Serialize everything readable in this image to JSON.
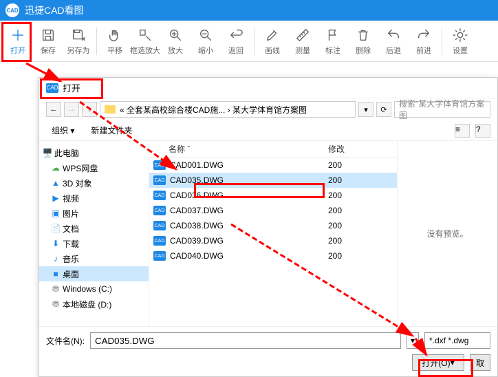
{
  "app": {
    "title": "迅捷CAD看图",
    "icon_text": "CAD"
  },
  "toolbar": [
    {
      "id": "open",
      "label": "打开",
      "accent": true,
      "icon": "plus"
    },
    {
      "id": "save",
      "label": "保存",
      "icon": "save"
    },
    {
      "id": "saveas",
      "label": "另存为",
      "icon": "saveas"
    },
    {
      "sep": true
    },
    {
      "id": "pan",
      "label": "平移",
      "icon": "hand"
    },
    {
      "id": "zoomwin",
      "label": "框选放大",
      "icon": "zoom-win"
    },
    {
      "id": "zoomin",
      "label": "放大",
      "icon": "zoom-in"
    },
    {
      "id": "zoomout",
      "label": "缩小",
      "icon": "zoom-out"
    },
    {
      "id": "back",
      "label": "返回",
      "icon": "return"
    },
    {
      "sep": true
    },
    {
      "id": "line",
      "label": "画线",
      "icon": "pen"
    },
    {
      "id": "measure",
      "label": "测量",
      "icon": "ruler"
    },
    {
      "id": "mark",
      "label": "标注",
      "icon": "flag"
    },
    {
      "id": "delete",
      "label": "删除",
      "icon": "trash"
    },
    {
      "id": "undo",
      "label": "后退",
      "icon": "undo"
    },
    {
      "id": "redo",
      "label": "前进",
      "icon": "redo"
    },
    {
      "sep": true
    },
    {
      "id": "settings",
      "label": "设置",
      "icon": "gear"
    }
  ],
  "dialog": {
    "title": "打开",
    "breadcrumb": "« 全套某高校综合楼CAD施... › 某大学体育馆方案图",
    "search_placeholder": "搜索\"某大学体育馆方案图",
    "organize": "组织",
    "newfolder": "新建文件夹",
    "col_name": "名称",
    "col_mod": "修改",
    "preview_text": "没有预览。",
    "filename_label": "文件名(N):",
    "filename_value": "CAD035.DWG",
    "filter": "*.dxf *.dwg",
    "open_btn": "打开(O)",
    "cancel_btn": "取"
  },
  "sidebar": [
    {
      "label": "此电脑",
      "icon": "🖥️",
      "color": "#1e88e5"
    },
    {
      "label": "WPS网盘",
      "icon": "☁",
      "color": "#4caf50",
      "sub": true
    },
    {
      "label": "3D 对象",
      "icon": "▲",
      "color": "#1e88e5",
      "sub": true
    },
    {
      "label": "视频",
      "icon": "▶",
      "color": "#1e88e5",
      "sub": true
    },
    {
      "label": "图片",
      "icon": "▣",
      "color": "#1e88e5",
      "sub": true
    },
    {
      "label": "文档",
      "icon": "📄",
      "color": "#1e88e5",
      "sub": true
    },
    {
      "label": "下载",
      "icon": "⬇",
      "color": "#1e88e5",
      "sub": true
    },
    {
      "label": "音乐",
      "icon": "♪",
      "color": "#1e88e5",
      "sub": true
    },
    {
      "label": "桌面",
      "icon": "■",
      "color": "#1e88e5",
      "sub": true,
      "selected": true
    },
    {
      "label": "Windows (C:)",
      "icon": "⛃",
      "color": "#888",
      "sub": true
    },
    {
      "label": "本地磁盘 (D:)",
      "icon": "⛃",
      "color": "#888",
      "sub": true
    }
  ],
  "files": [
    {
      "name": "CAD001.DWG",
      "mod": "200"
    },
    {
      "name": "CAD035.DWG",
      "mod": "200",
      "selected": true
    },
    {
      "name": "CAD036.DWG",
      "mod": "200"
    },
    {
      "name": "CAD037.DWG",
      "mod": "200"
    },
    {
      "name": "CAD038.DWG",
      "mod": "200"
    },
    {
      "name": "CAD039.DWG",
      "mod": "200"
    },
    {
      "name": "CAD040.DWG",
      "mod": "200"
    }
  ]
}
